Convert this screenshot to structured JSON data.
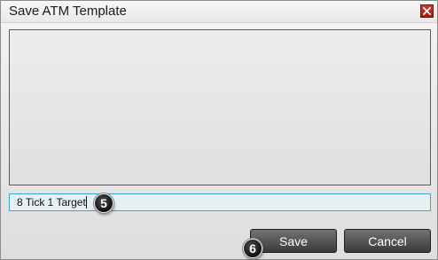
{
  "window": {
    "title": "Save ATM Template",
    "close_icon": "close-icon"
  },
  "templates_list": {
    "items": []
  },
  "name_field": {
    "value": "8 Tick 1 Target"
  },
  "markers": {
    "field_marker": "5",
    "save_marker": "6"
  },
  "buttons": {
    "save_label": "Save",
    "cancel_label": "Cancel"
  },
  "colors": {
    "field_border": "#38a8c8",
    "close_button": "#c0281c",
    "button_dark": "#3a3a3a"
  }
}
